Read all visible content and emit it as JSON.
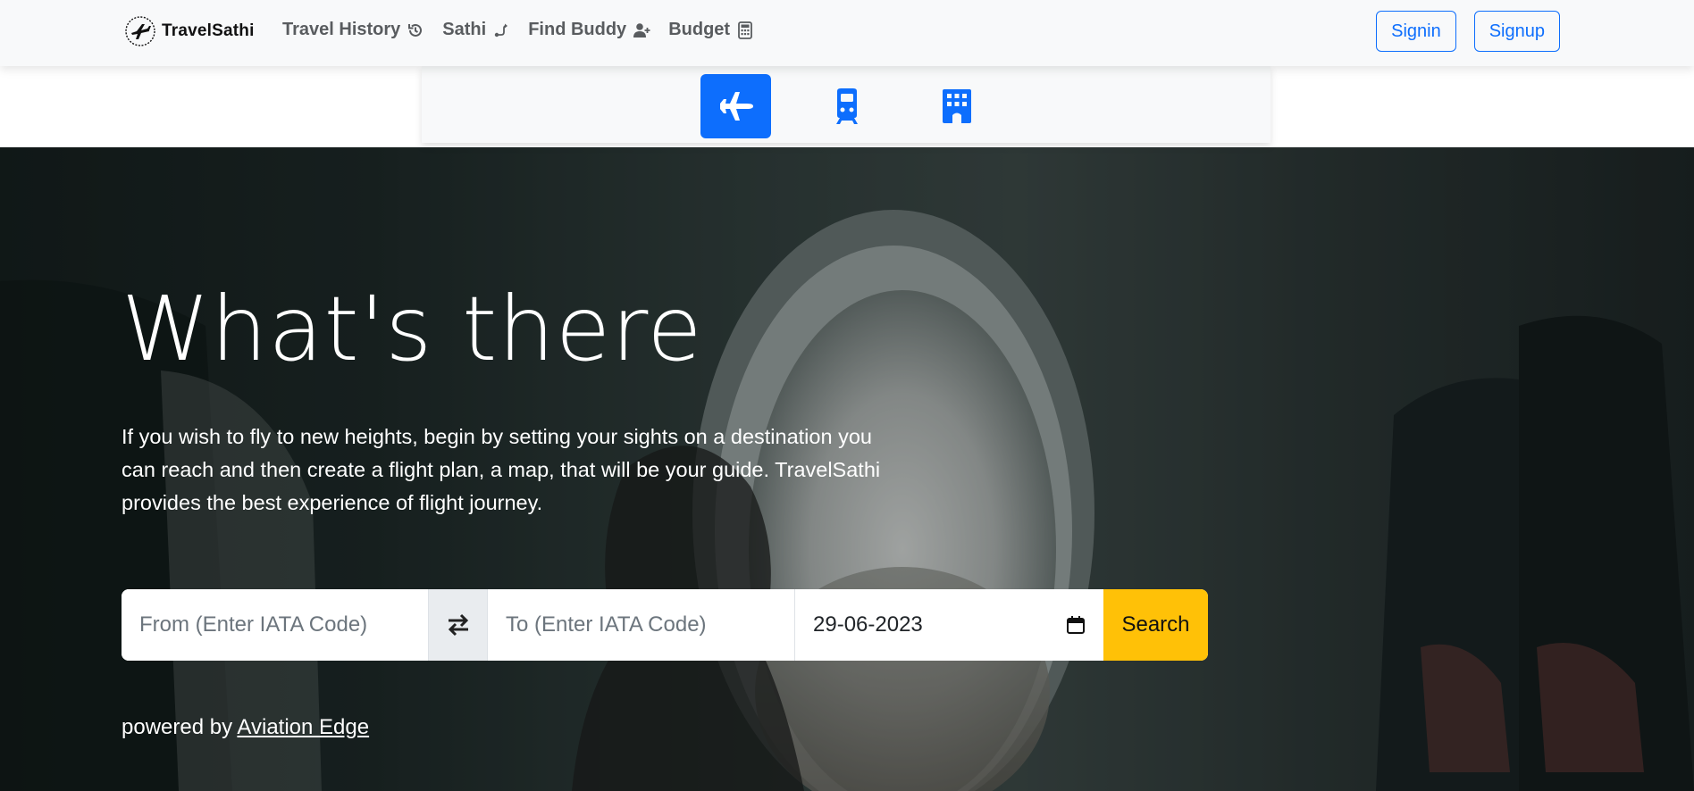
{
  "brand": {
    "name": "TravelSathi"
  },
  "nav": {
    "items": [
      {
        "label": "Travel History",
        "icon": "history-icon"
      },
      {
        "label": "Sathi",
        "icon": "route-icon"
      },
      {
        "label": "Find Buddy",
        "icon": "user-plus-icon"
      },
      {
        "label": "Budget",
        "icon": "calculator-icon"
      }
    ],
    "signin_label": "Signin",
    "signup_label": "Signup"
  },
  "tabs": [
    {
      "icon": "plane-icon",
      "active": true
    },
    {
      "icon": "train-icon",
      "active": false
    },
    {
      "icon": "hotel-icon",
      "active": false
    }
  ],
  "hero": {
    "title": "What's there",
    "description": "If you wish to fly to new heights, begin by setting your sights on a destination you can reach and then create a flight plan, a map, that will be your guide. TravelSathi provides the best experience of flight journey."
  },
  "search": {
    "from_placeholder": "From (Enter IATA Code)",
    "to_placeholder": "To (Enter IATA Code)",
    "date_value": "29-06-2023",
    "search_label": "Search"
  },
  "footer": {
    "powered_prefix": "powered by",
    "powered_link": "Aviation Edge"
  },
  "colors": {
    "primary": "#0d6efd",
    "warning": "#ffc107",
    "navbar_bg": "#f8f9fa"
  }
}
